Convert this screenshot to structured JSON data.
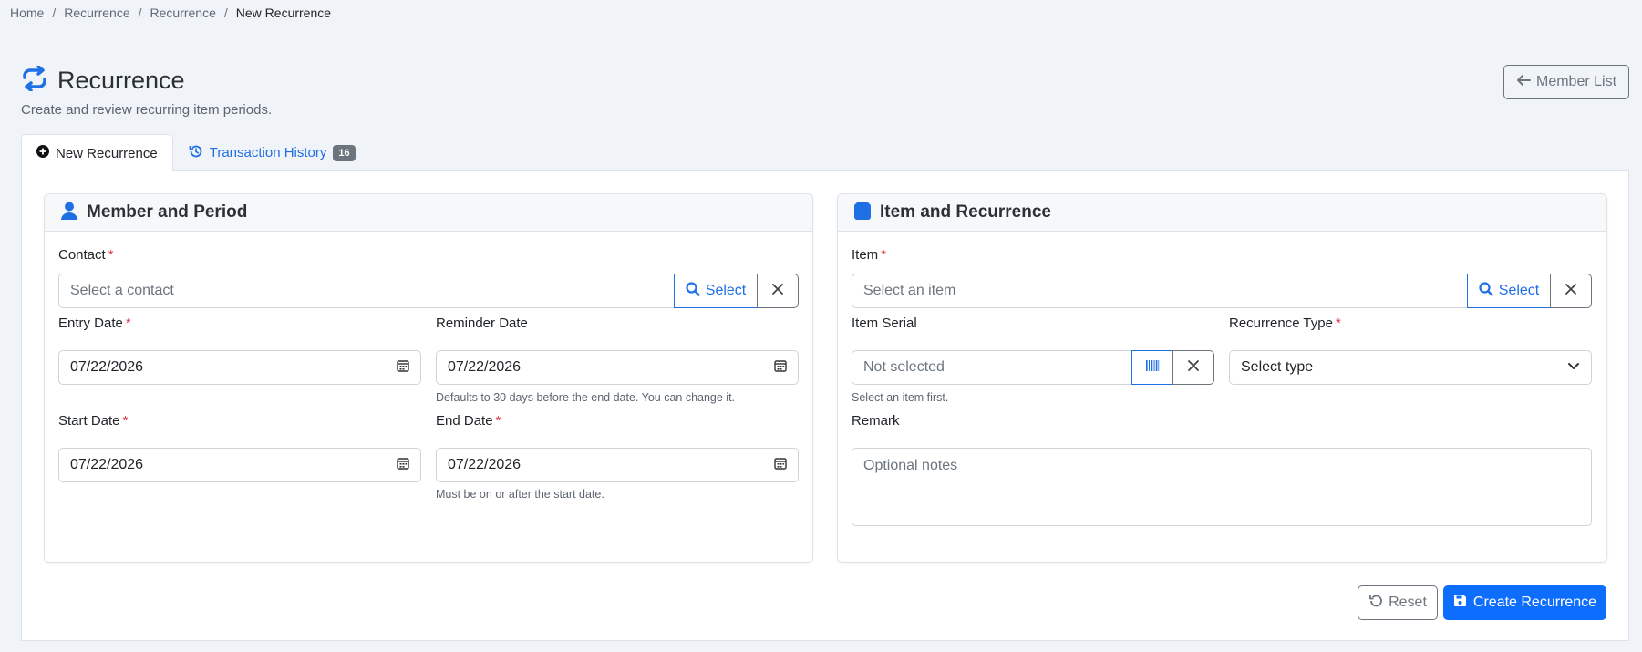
{
  "breadcrumb": [
    "Home",
    "Recurrence",
    "Recurrence",
    "New Recurrence"
  ],
  "page": {
    "title": "Recurrence",
    "subtitle": "Create and review recurring item periods.",
    "member_list_label": "Member List"
  },
  "tabs": {
    "new_label": "New Recurrence",
    "history_label": "Transaction History",
    "history_count": "16"
  },
  "member_card": {
    "title": "Member and Period",
    "contact_label": "Contact",
    "contact_placeholder": "Select a contact",
    "select_label": "Select",
    "entry_date_label": "Entry Date",
    "entry_date_value": "07/22/2026",
    "reminder_date_label": "Reminder Date",
    "reminder_date_value": "07/22/2026",
    "reminder_help": "Defaults to 30 days before the end date. You can change it.",
    "start_date_label": "Start Date",
    "start_date_value": "07/22/2026",
    "end_date_label": "End Date",
    "end_date_value": "07/22/2026",
    "end_help": "Must be on or after the start date."
  },
  "item_card": {
    "title": "Item and Recurrence",
    "item_label": "Item",
    "item_placeholder": "Select an item",
    "select_label": "Select",
    "serial_label": "Item Serial",
    "serial_placeholder": "Not selected",
    "serial_help": "Select an item first.",
    "type_label": "Recurrence Type",
    "type_value": "Select type",
    "remark_label": "Remark",
    "remark_placeholder": "Optional notes"
  },
  "actions": {
    "reset_label": "Reset",
    "create_label": "Create Recurrence"
  },
  "colors": {
    "primary": "#0d6efd",
    "required": "#dc3545",
    "secondary": "#6c757d"
  }
}
